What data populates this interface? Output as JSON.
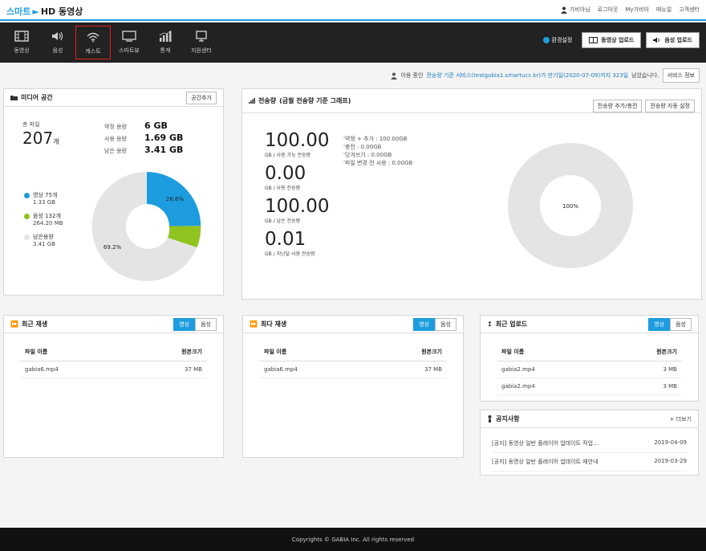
{
  "header": {
    "logo_part1": "스마트",
    "logo_part2": "HD 동영상",
    "user_name": "가비아님",
    "links": [
      "로그아웃",
      "My가비아",
      "매뉴얼",
      "고객센터"
    ]
  },
  "nav": {
    "items": [
      {
        "label": "동영상",
        "icon": "film-icon"
      },
      {
        "label": "음성",
        "icon": "speaker-icon"
      },
      {
        "label": "캐스트",
        "icon": "wifi-icon",
        "active": true
      },
      {
        "label": "스마트뷰",
        "icon": "monitor-icon"
      },
      {
        "label": "통계",
        "icon": "bar-chart-icon"
      },
      {
        "label": "지원센터",
        "icon": "desktop-icon"
      }
    ],
    "env_label": "환경설정",
    "upload_video": "동영상 업로드",
    "upload_audio": "음성 업로드"
  },
  "infoline": {
    "text_pre": "이용 중인",
    "text_blue": "전송량 기준 서비스(testgabia1.smartucc.kr)가 만기일(2020-07-09)까지 323일",
    "text_post": "남았습니다.",
    "button": "서비스 정보"
  },
  "media": {
    "title": "미디어 공간",
    "add_button": "공간추가",
    "total_label": "총 파일",
    "total_count": "207",
    "total_unit": "개",
    "usage": [
      {
        "k": "약정 용량",
        "v": "6 GB"
      },
      {
        "k": "사용 용량",
        "v": "1.69 GB"
      },
      {
        "k": "남은 용량",
        "v": "3.41 GB"
      }
    ],
    "legend": [
      {
        "name": "영상 75개",
        "size": "1.33 GB",
        "color": "#1d9ce0"
      },
      {
        "name": "음성 132개",
        "size": "264.20 MB",
        "color": "#8fc31f"
      },
      {
        "name": "남은용량",
        "size": "3.41 GB",
        "color": "#e4e4e4"
      }
    ],
    "pie_labels": [
      "26.6%",
      "69.2%"
    ]
  },
  "transfer": {
    "title": "전송량",
    "subtitle": "(금월 전송량 기준 그래프)",
    "btn_add": "전송량 추가/충전",
    "btn_auto": "전송량 자동 설정",
    "items": [
      {
        "num": "100.00",
        "cap": "GB / 사용 가능 전송량"
      },
      {
        "num": "0.00",
        "cap": "GB / 사용 전송량"
      },
      {
        "num": "100.00",
        "cap": "GB / 남은 전송량"
      },
      {
        "num": "0.01",
        "cap": "GB / 지난달 사용 전송량"
      }
    ],
    "info": [
      "약정 + 추가 : 100.00GB",
      "충전 : 0.00GB",
      "당겨쓰기 : 0.00GB",
      "파일 변경 전 사용 : 0.00GB"
    ],
    "pie_label": "100%"
  },
  "recent_play": {
    "title": "최근 재생",
    "tabs": [
      "영상",
      "음성"
    ],
    "col_name": "파일 이름",
    "col_size": "원본크기",
    "rows": [
      {
        "name": "gabia6.mp4",
        "size": "37 MB"
      }
    ]
  },
  "most_play": {
    "title": "최다 재생",
    "tabs": [
      "영상",
      "음성"
    ],
    "col_name": "파일 이름",
    "col_size": "원본크기",
    "rows": [
      {
        "name": "gabia6.mp4",
        "size": "37 MB"
      }
    ]
  },
  "recent_upload": {
    "title": "최근 업로드",
    "tabs": [
      "영상",
      "음성"
    ],
    "col_name": "파일 이름",
    "col_size": "원본크기",
    "rows": [
      {
        "name": "gabia2.mp4",
        "size": "3 MB"
      },
      {
        "name": "gabia2.mp4",
        "size": "3 MB"
      }
    ]
  },
  "notice": {
    "title": "공지사항",
    "more": "+ 더보기",
    "rows": [
      {
        "title": "[공지] 동영상 일반 플레이어 업데이트 작업…",
        "date": "2019-04-09"
      },
      {
        "title": "[공지] 동영상 일반 플레이어 업데이트 재안내",
        "date": "2019-03-29"
      }
    ]
  },
  "footer": {
    "text": "Copyrights © GABIA Inc. All rights reserved"
  },
  "colors": {
    "accent": "#1d9ce0",
    "green": "#8fc31f",
    "remain": "#e4e4e4",
    "nav_bg": "#222222"
  }
}
